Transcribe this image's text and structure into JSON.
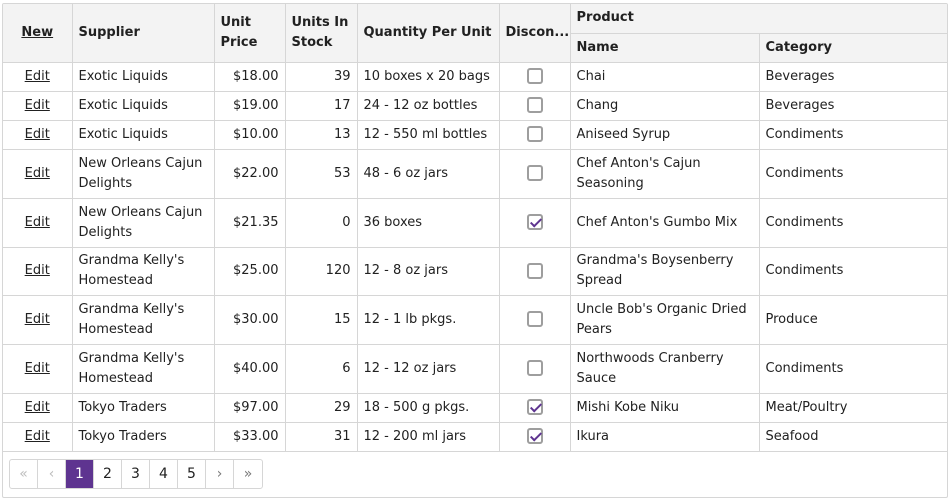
{
  "grid": {
    "header": {
      "command": "New",
      "supplier": "Supplier",
      "unit_price": "Unit Price",
      "units_in_stock": "Units In Stock",
      "quantity_per_unit": "Quantity Per Unit",
      "discontinued": "Discon...",
      "product_group": "Product",
      "name": "Name",
      "category": "Category"
    },
    "edit_label": "Edit",
    "rows": [
      {
        "supplier": "Exotic Liquids",
        "price": "$18.00",
        "stock": "39",
        "qty": "10 boxes x 20 bags",
        "discontinued": false,
        "name": "Chai",
        "category": "Beverages"
      },
      {
        "supplier": "Exotic Liquids",
        "price": "$19.00",
        "stock": "17",
        "qty": "24 - 12 oz bottles",
        "discontinued": false,
        "name": "Chang",
        "category": "Beverages"
      },
      {
        "supplier": "Exotic Liquids",
        "price": "$10.00",
        "stock": "13",
        "qty": "12 - 550 ml bottles",
        "discontinued": false,
        "name": "Aniseed Syrup",
        "category": "Condiments"
      },
      {
        "supplier": "New Orleans Cajun Delights",
        "price": "$22.00",
        "stock": "53",
        "qty": "48 - 6 oz jars",
        "discontinued": false,
        "name": "Chef Anton's Cajun Seasoning",
        "category": "Condiments"
      },
      {
        "supplier": "New Orleans Cajun Delights",
        "price": "$21.35",
        "stock": "0",
        "qty": "36 boxes",
        "discontinued": true,
        "name": "Chef Anton's Gumbo Mix",
        "category": "Condiments"
      },
      {
        "supplier": "Grandma Kelly's Homestead",
        "price": "$25.00",
        "stock": "120",
        "qty": "12 - 8 oz jars",
        "discontinued": false,
        "name": "Grandma's Boysenberry Spread",
        "category": "Condiments"
      },
      {
        "supplier": "Grandma Kelly's Homestead",
        "price": "$30.00",
        "stock": "15",
        "qty": "12 - 1 lb pkgs.",
        "discontinued": false,
        "name": "Uncle Bob's Organic Dried Pears",
        "category": "Produce"
      },
      {
        "supplier": "Grandma Kelly's Homestead",
        "price": "$40.00",
        "stock": "6",
        "qty": "12 - 12 oz jars",
        "discontinued": false,
        "name": "Northwoods Cranberry Sauce",
        "category": "Condiments"
      },
      {
        "supplier": "Tokyo Traders",
        "price": "$97.00",
        "stock": "29",
        "qty": "18 - 500 g pkgs.",
        "discontinued": true,
        "name": "Mishi Kobe Niku",
        "category": "Meat/Poultry"
      },
      {
        "supplier": "Tokyo Traders",
        "price": "$33.00",
        "stock": "31",
        "qty": "12 - 200 ml jars",
        "discontinued": true,
        "name": "Ikura",
        "category": "Seafood"
      }
    ]
  },
  "pager": {
    "first_icon": "«",
    "prev_icon": "‹",
    "next_icon": "›",
    "last_icon": "»",
    "pages": [
      "1",
      "2",
      "3",
      "4",
      "5"
    ],
    "current_page": "1",
    "accent_color": "#5e3490"
  }
}
